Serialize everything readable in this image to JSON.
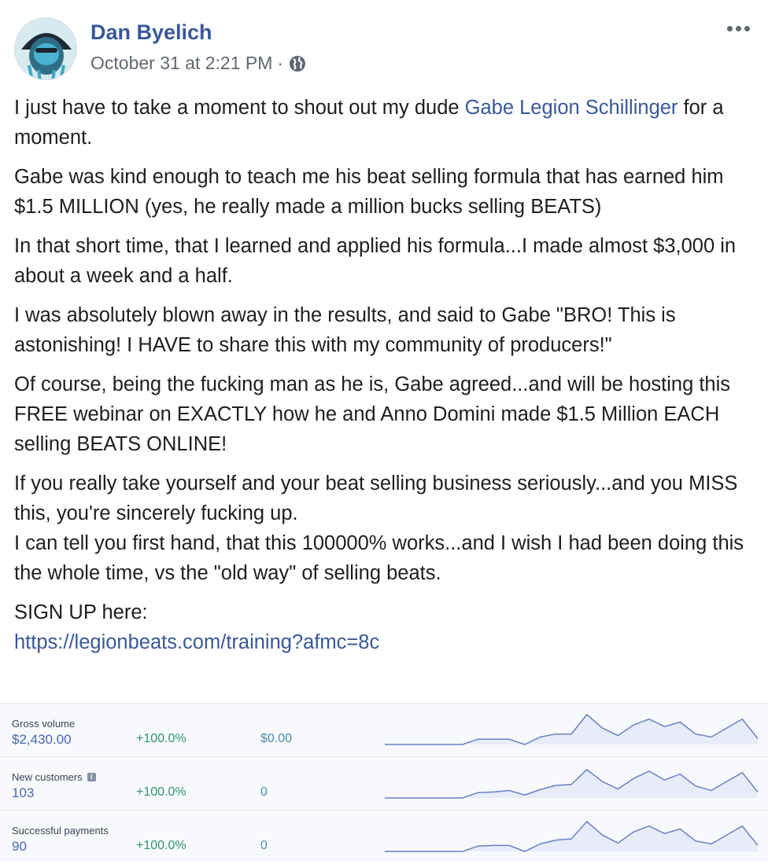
{
  "post": {
    "author": "Dan Byelich",
    "date": "October 31 at 2:21 PM",
    "separator": "·",
    "privacy_icon": "globe-icon",
    "more_icon": "more-options-icon",
    "paragraphs": {
      "p1_text_a": "I just have to take a moment to shout out my dude ",
      "p1_mention": "Gabe Legion Schillinger",
      "p1_text_b": " for a moment.",
      "p2": "Gabe was kind enough to teach me his beat selling formula that has earned him $1.5 MILLION (yes, he really made a million bucks selling BEATS)",
      "p3": "In that short time, that I learned and applied his formula...I made almost $3,000 in about a week and a half.",
      "p4": "I was absolutely blown away in the results, and said to Gabe \"BRO! This is astonishing! I HAVE to share this with my community of producers!\"",
      "p5": "Of course, being the fucking man as he is, Gabe agreed...and will be hosting this FREE webinar on EXACTLY how he and Anno Domini made $1.5 Million EACH selling BEATS ONLINE!",
      "p6_line1": "If you really take yourself and your beat selling business seriously...and you MISS this, you're sincerely fucking up.",
      "p6_line2": "I can tell you first hand, that this 100000% works...and I wish I had been doing this the whole time, vs the \"old way\" of selling beats.",
      "p7_text": "SIGN UP here:",
      "p7_link": "https://legionbeats.com/training?afmc=8c"
    }
  },
  "stats": [
    {
      "label": "Gross volume",
      "value": "$2,430.00",
      "change": "+100.0%",
      "previous": "$0.00",
      "has_info": false,
      "spark": [
        0,
        0,
        0,
        0,
        0,
        0,
        0.18,
        0.18,
        0.18,
        0,
        0.25,
        0.35,
        0.35,
        1,
        0.55,
        0.3,
        0.65,
        0.85,
        0.6,
        0.75,
        0.35,
        0.25,
        0.55,
        0.85,
        0.2
      ]
    },
    {
      "label": "New customers",
      "value": "103",
      "change": "+100.0%",
      "previous": "0",
      "has_info": true,
      "spark": [
        0,
        0,
        0,
        0,
        0,
        0,
        0.18,
        0.2,
        0.25,
        0.1,
        0.28,
        0.42,
        0.45,
        0.95,
        0.55,
        0.3,
        0.65,
        0.9,
        0.6,
        0.8,
        0.4,
        0.25,
        0.55,
        0.85,
        0.2
      ]
    },
    {
      "label": "Successful payments",
      "value": "90",
      "change": "+100.0%",
      "previous": "0",
      "has_info": false,
      "spark": [
        0,
        0,
        0,
        0,
        0,
        0,
        0.18,
        0.2,
        0.2,
        0,
        0.25,
        0.38,
        0.42,
        1,
        0.55,
        0.28,
        0.65,
        0.85,
        0.6,
        0.75,
        0.35,
        0.25,
        0.55,
        0.85,
        0.2
      ]
    }
  ],
  "colors": {
    "accent": "#385898",
    "spark_line": "#6b7fc4",
    "spark_fill": "#e8ecf9",
    "positive": "#2e9470"
  }
}
